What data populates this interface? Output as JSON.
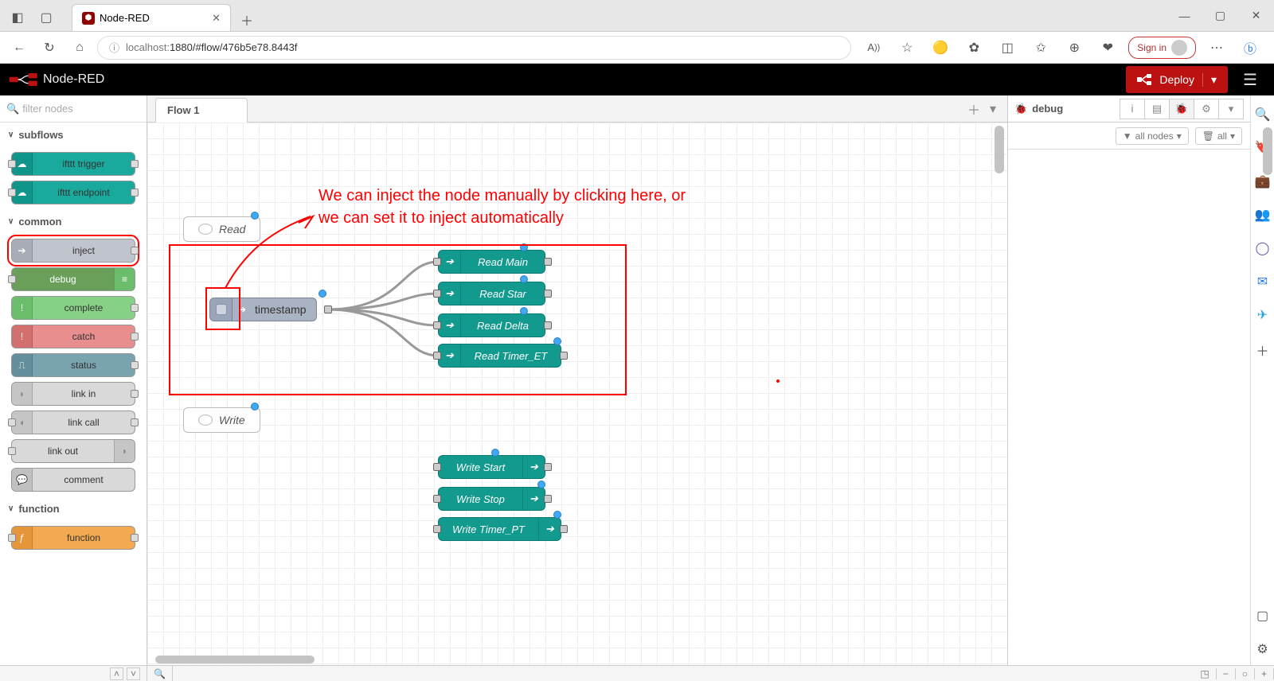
{
  "browser": {
    "tab_title": "Node-RED",
    "url": "localhost:1880/#flow/476b5e78.8443f",
    "url_prefix": "localhost:",
    "url_rest": "1880/#flow/476b5e78.8443f",
    "signin": "Sign in"
  },
  "header": {
    "title": "Node-RED",
    "deploy": "Deploy"
  },
  "palette": {
    "filter_placeholder": "filter nodes",
    "categories": {
      "subflows": "subflows",
      "common": "common",
      "function": "function"
    },
    "nodes": {
      "ifttt_trigger": "ifttt trigger",
      "ifttt_endpoint": "ifttt endpoint",
      "inject": "inject",
      "debug": "debug",
      "complete": "complete",
      "catch": "catch",
      "status": "status",
      "link_in": "link in",
      "link_call": "link call",
      "link_out": "link out",
      "comment": "comment",
      "function": "function"
    }
  },
  "workspace": {
    "flow_tab": "Flow 1",
    "comments": {
      "read": "Read",
      "write": "Write"
    },
    "inject_label": "timestamp",
    "read_nodes": [
      "Read Main",
      "Read Star",
      "Read Delta",
      "Read Timer_ET"
    ],
    "write_nodes": [
      "Write Start",
      "Write Stop",
      "Write Timer_PT"
    ]
  },
  "annotation": {
    "line1": "We can inject the node manually by clicking here, or",
    "line2": "we can set it to inject automatically"
  },
  "sidebar": {
    "tab": "debug",
    "filter_all_nodes": "all nodes",
    "filter_all": "all"
  }
}
